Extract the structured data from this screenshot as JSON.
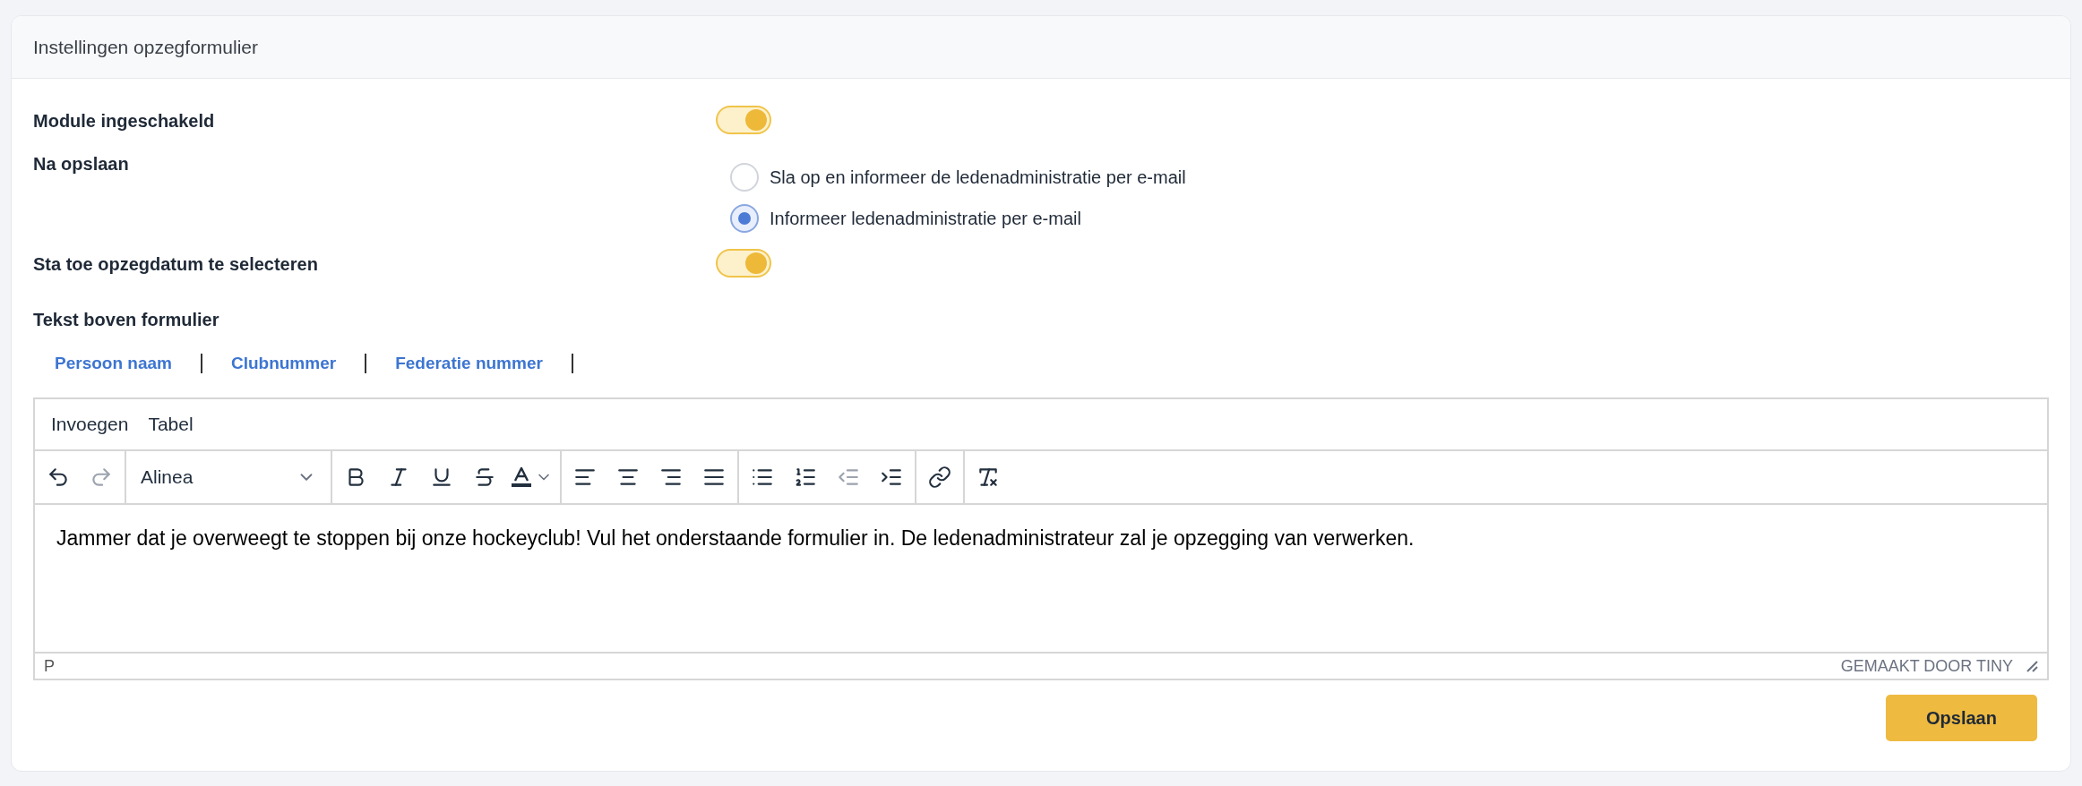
{
  "card": {
    "title": "Instellingen opzegformulier"
  },
  "settings": [
    {
      "kind": "toggle",
      "label": "Module ingeschakeld",
      "on": true
    },
    {
      "kind": "radio",
      "label": "Na opslaan",
      "options": [
        {
          "label": "Sla op en informeer de ledenadministratie per e-mail",
          "selected": false
        },
        {
          "label": "Informeer ledenadministratie per e-mail",
          "selected": true
        }
      ]
    },
    {
      "kind": "toggle",
      "label": "Sta toe opzegdatum te selecteren",
      "on": true
    }
  ],
  "editor_section": {
    "label": "Tekst boven formulier",
    "merge_fields": [
      "Persoon naam",
      "Clubnummer",
      "Federatie nummer"
    ],
    "menu": [
      "Invoegen",
      "Tabel"
    ],
    "toolbar": [
      [
        {
          "kind": "undo",
          "disabled": false
        },
        {
          "kind": "redo",
          "disabled": true
        }
      ],
      [
        {
          "kind": "format-select",
          "value": "Alinea",
          "disabled": false
        }
      ],
      [
        {
          "kind": "bold",
          "disabled": false
        },
        {
          "kind": "italic",
          "disabled": false
        },
        {
          "kind": "underline",
          "disabled": false
        },
        {
          "kind": "strikethrough",
          "disabled": false
        },
        {
          "kind": "text-color",
          "disabled": false
        }
      ],
      [
        {
          "kind": "align-left",
          "disabled": false
        },
        {
          "kind": "align-center",
          "disabled": false
        },
        {
          "kind": "align-right",
          "disabled": false
        },
        {
          "kind": "align-justify",
          "disabled": false
        }
      ],
      [
        {
          "kind": "bullet-list",
          "disabled": false
        },
        {
          "kind": "numbered-list",
          "disabled": false
        },
        {
          "kind": "outdent",
          "disabled": true
        },
        {
          "kind": "indent",
          "disabled": false
        }
      ],
      [
        {
          "kind": "link",
          "disabled": false
        }
      ],
      [
        {
          "kind": "clear-format",
          "disabled": false
        }
      ]
    ],
    "content": "Jammer dat je overweegt te stoppen bij onze hockeyclub! Vul het onderstaande formulier in. De ledenadministrateur zal je opzegging van verwerken.",
    "path": "P",
    "branding": "GEMAAKT DOOR TINY"
  },
  "save_button": "Opslaan"
}
